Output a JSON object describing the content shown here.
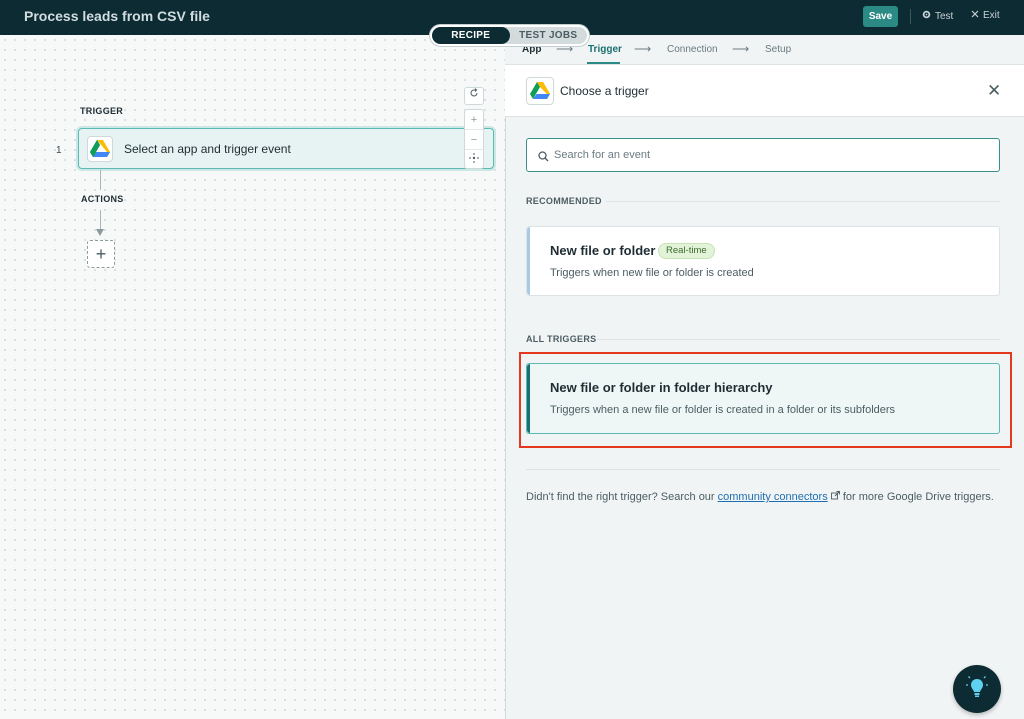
{
  "header": {
    "title": "Process leads from CSV file",
    "save_label": "Save",
    "test_label": "Test",
    "exit_label": "Exit"
  },
  "mode_tabs": {
    "recipe": "RECIPE",
    "test_jobs": "TEST JOBS",
    "active": "recipe"
  },
  "canvas": {
    "trigger_label": "TRIGGER",
    "step_number": "1",
    "trigger_card_text": "Select an app and trigger event",
    "actions_label": "ACTIONS",
    "add_step_symbol": "+",
    "zoom_in_symbol": "+",
    "zoom_out_symbol": "−"
  },
  "wizard": {
    "steps": [
      "App",
      "Trigger",
      "Connection",
      "Setup"
    ],
    "active": "Trigger",
    "arrow_glyph": "⟶"
  },
  "panel": {
    "title": "Choose a trigger",
    "app_icon": "google-drive-icon",
    "close_symbol": "✕"
  },
  "search": {
    "placeholder": "Search for an event",
    "value": ""
  },
  "recommended": {
    "label": "RECOMMENDED",
    "items": [
      {
        "title": "New file or folder",
        "badge": "Real-time",
        "description": "Triggers when new file or folder is created"
      }
    ]
  },
  "all_triggers": {
    "label": "ALL TRIGGERS",
    "items": [
      {
        "title": "New file or folder in folder hierarchy",
        "description": "Triggers when a new file or folder is created in a folder or its subfolders"
      }
    ]
  },
  "footer": {
    "text_before": "Didn't find the right trigger? Search our ",
    "link_text": "community connectors",
    "text_after": " for more Google Drive triggers."
  },
  "colors": {
    "header_bg": "#0c2b33",
    "accent_teal": "#2b8a84",
    "highlight_red": "#e2391f",
    "link_blue": "#1f6fb0"
  }
}
